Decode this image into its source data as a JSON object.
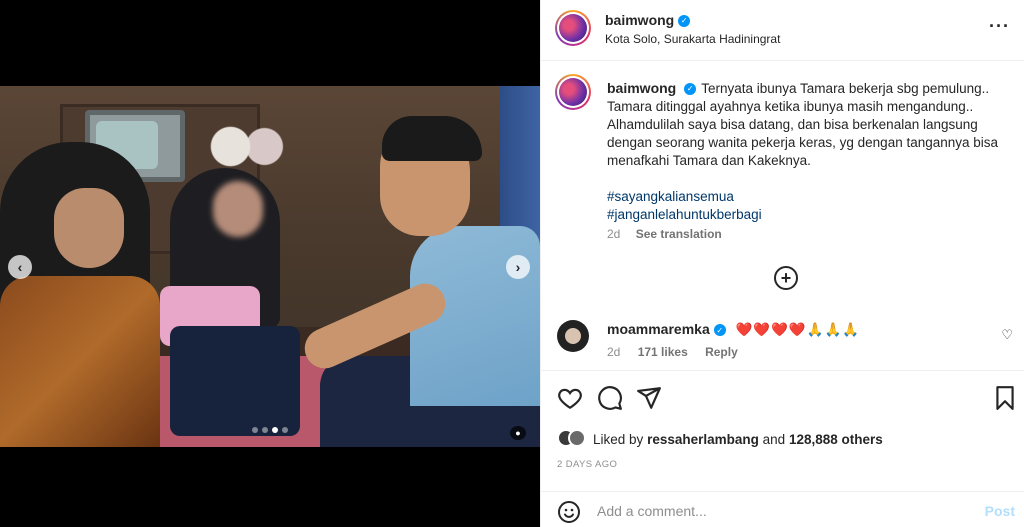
{
  "post": {
    "username": "baimwong",
    "location": "Kota Solo, Surakarta Hadiningrat",
    "caption": "Ternyata ibunya Tamara bekerja sbg pemulung.. Tamara ditinggal ayahnya ketika ibunya masih mengandung.. Alhamdulilah saya bisa datang, dan bisa berkenalan langsung dengan seorang wanita pekerja keras, yg dengan tangannya bisa menafkahi Tamara dan Kakeknya.",
    "hashtags": [
      "#sayangkaliansemua",
      "#janganlelahuntukberbagi"
    ],
    "caption_age": "2d",
    "see_translation": "See translation",
    "more_icon": "more-horizontal-icon"
  },
  "media": {
    "carousel_count": 4,
    "active_index": 2
  },
  "comment": {
    "username": "moammaremka",
    "body": "❤️❤️❤️❤️🙏🙏🙏",
    "age": "2d",
    "likes": "171 likes",
    "reply": "Reply"
  },
  "actions": {
    "liked_prefix": "Liked by",
    "liked_user": "ressaherlambang",
    "liked_and": "and",
    "liked_count": "128,888 others",
    "time_ago": "2 DAYS AGO"
  },
  "composer": {
    "placeholder": "Add a comment...",
    "post_label": "Post"
  },
  "colors": {
    "accent": "#0095f6",
    "hashtag": "#00376b",
    "post_disabled": "#b2dffc"
  }
}
